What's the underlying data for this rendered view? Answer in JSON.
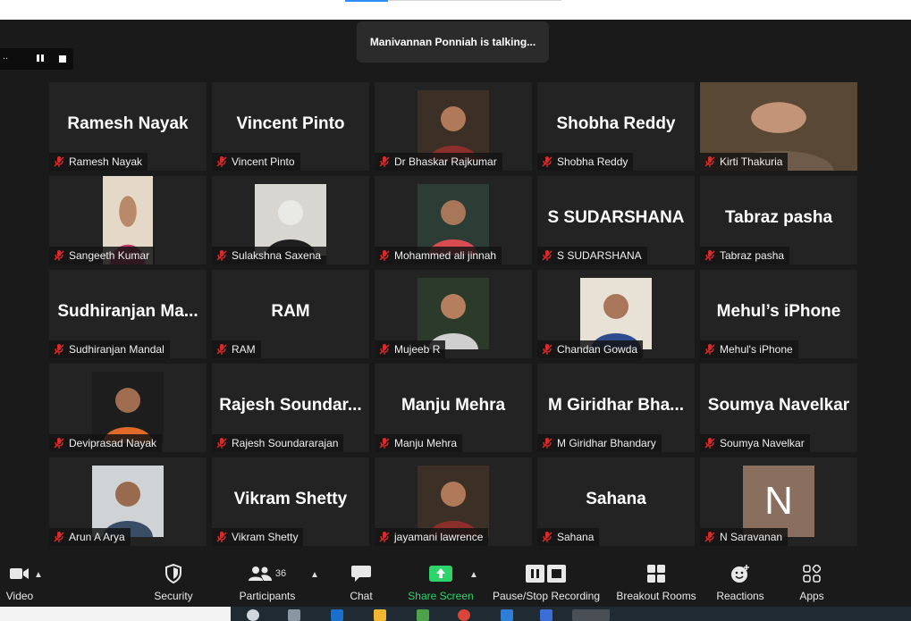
{
  "meeting": {
    "talking_text": "Manivannan Ponniah is talking...",
    "recording_prefix": ".."
  },
  "participants": [
    {
      "big": "Ramesh Nayak",
      "label": "Ramesh Nayak",
      "kind": "name"
    },
    {
      "big": "Vincent Pinto",
      "label": "Vincent Pinto",
      "kind": "name"
    },
    {
      "big": "",
      "label": "Dr Bhaskar Rajkumar",
      "kind": "photo"
    },
    {
      "big": "Shobha Reddy",
      "label": "Shobha Reddy",
      "kind": "name"
    },
    {
      "big": "",
      "label": "Kirti Thakuria",
      "kind": "video"
    },
    {
      "big": "",
      "label": "Sangeeth Kumar",
      "kind": "photo-tall"
    },
    {
      "big": "",
      "label": "Sulakshna Saxena",
      "kind": "photo"
    },
    {
      "big": "",
      "label": "Mohammed ali jinnah",
      "kind": "photo"
    },
    {
      "big": "S SUDARSHANA",
      "label": "S SUDARSHANA",
      "kind": "name"
    },
    {
      "big": "Tabraz pasha",
      "label": "Tabraz pasha",
      "kind": "name"
    },
    {
      "big": "Sudhiranjan  Ma...",
      "label": "Sudhiranjan Mandal",
      "kind": "name"
    },
    {
      "big": "RAM",
      "label": "RAM",
      "kind": "name"
    },
    {
      "big": "",
      "label": "Mujeeb R",
      "kind": "photo"
    },
    {
      "big": "",
      "label": "Chandan Gowda",
      "kind": "photo"
    },
    {
      "big": "Mehul’s iPhone",
      "label": "Mehul's iPhone",
      "kind": "name"
    },
    {
      "big": "",
      "label": "Deviprasad Nayak",
      "kind": "photo"
    },
    {
      "big": "Rajesh  Soundar...",
      "label": "Rajesh Soundararajan",
      "kind": "name"
    },
    {
      "big": "Manju Mehra",
      "label": "Manju Mehra",
      "kind": "name"
    },
    {
      "big": "M  Giridhar  Bha...",
      "label": "M Giridhar Bhandary",
      "kind": "name"
    },
    {
      "big": "Soumya Navelkar",
      "label": "Soumya Navelkar",
      "kind": "name"
    },
    {
      "big": "",
      "label": "Arun A Arya",
      "kind": "photo"
    },
    {
      "big": "Vikram Shetty",
      "label": "Vikram Shetty",
      "kind": "name"
    },
    {
      "big": "",
      "label": "jayamani lawrence",
      "kind": "photo"
    },
    {
      "big": "Sahana",
      "label": "Sahana",
      "kind": "name"
    },
    {
      "big": "N",
      "label": "N Saravanan",
      "kind": "letter"
    }
  ],
  "toolbar": {
    "video": "Video",
    "security": "Security",
    "participants": "Participants",
    "participants_count": "36",
    "chat": "Chat",
    "share_screen": "Share Screen",
    "pause_stop": "Pause/Stop Recording",
    "breakout": "Breakout Rooms",
    "reactions": "Reactions",
    "apps": "Apps"
  },
  "colors": {
    "accent": "#2d8cff",
    "share_green": "#2ed36a",
    "muted_red": "#e02828"
  }
}
